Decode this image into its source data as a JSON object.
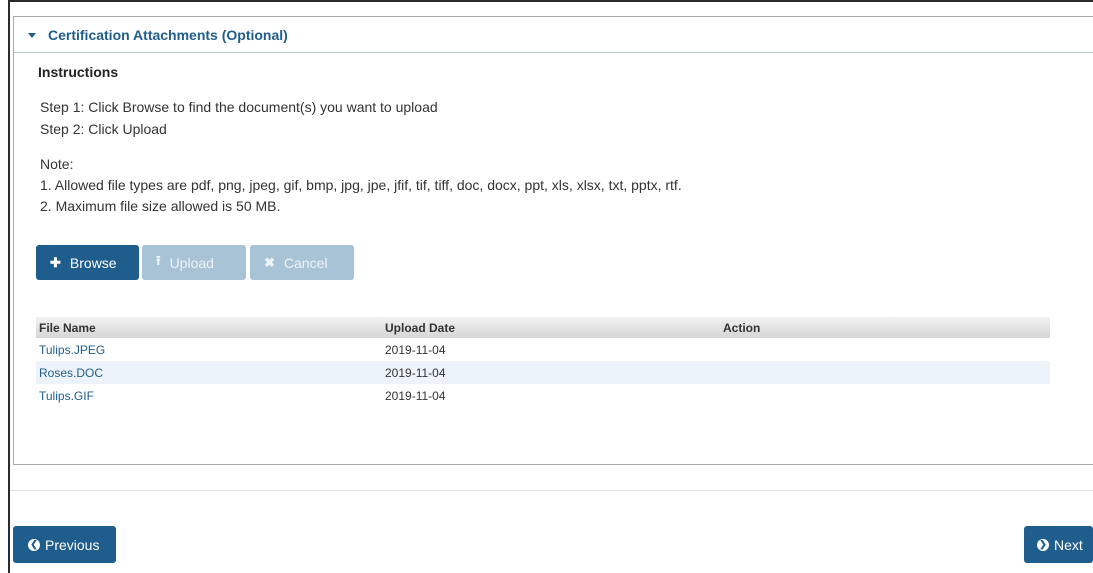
{
  "panel": {
    "title": "Certification Attachments (Optional)"
  },
  "instructions": {
    "heading": "Instructions",
    "step1": "Step 1: Click Browse to find the document(s) you want to upload",
    "step2": "Step 2: Click Upload",
    "note_label": "Note:",
    "note1": "1. Allowed file types are pdf, png, jpeg, gif, bmp, jpg, jpe, jfif, tif, tiff, doc, docx, ppt, xls, xlsx, txt, pptx, rtf.",
    "note2": "2. Maximum file size allowed is 50 MB."
  },
  "toolbar": {
    "browse_label": "Browse",
    "upload_label": "Upload",
    "cancel_label": "Cancel",
    "browse_icon": "plus-icon",
    "upload_icon": "upload-icon",
    "cancel_icon": "x-icon"
  },
  "table": {
    "headers": [
      "File Name",
      "Upload Date",
      "Action"
    ],
    "rows": [
      {
        "file_name": "Tulips.JPEG",
        "upload_date": "2019-11-04",
        "action": ""
      },
      {
        "file_name": "Roses.DOC",
        "upload_date": "2019-11-04",
        "action": ""
      },
      {
        "file_name": "Tulips.GIF",
        "upload_date": "2019-11-04",
        "action": ""
      }
    ]
  },
  "nav": {
    "previous_label": "Previous",
    "next_label": "Next"
  },
  "colors": {
    "primary": "#1f5d8c",
    "disabled": "#a8c2d6",
    "row_alt": "#edf3fa"
  }
}
